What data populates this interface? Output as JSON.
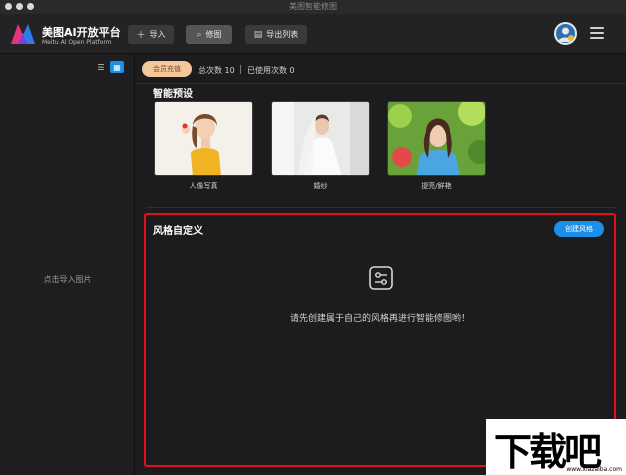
{
  "window": {
    "title": "美图智能修图"
  },
  "header": {
    "brand_name": "美图AI开放平台",
    "brand_sub": "Meitu AI Open Platform",
    "import_label": "导入",
    "retouch_label": "修图",
    "export_label": "导出列表"
  },
  "sidebar": {
    "view_list_icon": "list-icon",
    "view_grid_icon": "grid-icon",
    "hint": "点击导入图片"
  },
  "main": {
    "recharge_label": "会员充值",
    "total_count": "总次数 10",
    "used_count": "已使用次数 0",
    "presets_title": "智能预设",
    "presets": [
      {
        "label": "人像写真"
      },
      {
        "label": "婚纱"
      },
      {
        "label": "提亮/鲜艳"
      }
    ],
    "custom_title": "风格自定义",
    "create_label": "创建风格",
    "empty_text": "请先创建属于自己的风格再进行智能修图哟！"
  },
  "watermark": {
    "text": "下载吧",
    "url": "www.xiazaiba.com"
  },
  "colors": {
    "accent": "#1d8fe8",
    "highlight_border": "#e3101c",
    "recharge_bg": "#f3c79a"
  }
}
